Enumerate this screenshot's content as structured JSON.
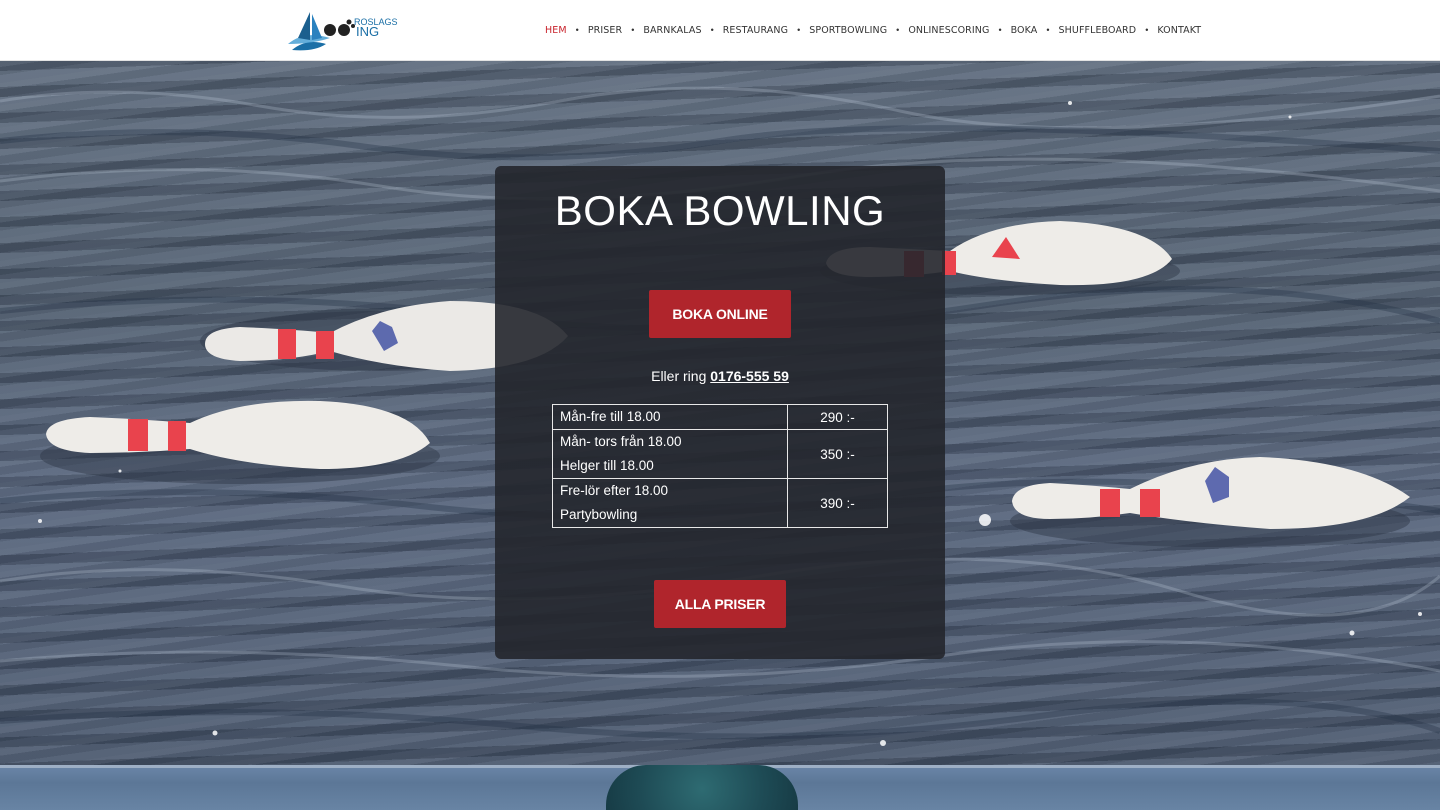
{
  "header": {
    "logo": {
      "text_top": "ROSLAGS",
      "text_bottom": "ING",
      "brand_colors": [
        "#1b6fa6",
        "#222222"
      ]
    },
    "nav": [
      {
        "label": "HEM",
        "active": true
      },
      {
        "label": "PRISER",
        "active": false
      },
      {
        "label": "BARNKALAS",
        "active": false
      },
      {
        "label": "RESTAURANG",
        "active": false
      },
      {
        "label": "SPORTBOWLING",
        "active": false
      },
      {
        "label": "ONLINESCORING",
        "active": false
      },
      {
        "label": "BOKA",
        "active": false
      },
      {
        "label": "SHUFFLEBOARD",
        "active": false
      },
      {
        "label": "KONTAKT",
        "active": false
      }
    ],
    "separator": "•",
    "active_color": "#c8232c"
  },
  "hero": {
    "background": "bowling-pins-floating-in-water",
    "title": "BOKA BOWLING",
    "book_online_label": "BOKA ONLINE",
    "call_prefix": "Eller ring",
    "phone": "0176-555 59",
    "prices": [
      {
        "lines": [
          "Mån-fre till 18.00"
        ],
        "price": "290 :-"
      },
      {
        "lines": [
          "Mån- tors från 18.00",
          "Helger till 18.00"
        ],
        "price": "350 :-"
      },
      {
        "lines": [
          "Fre-lör efter 18.00",
          "Partybowling"
        ],
        "price": "390 :-"
      }
    ],
    "all_prices_label": "ALLA PRISER",
    "button_color": "#b0252c",
    "panel_color": "#23262c"
  }
}
